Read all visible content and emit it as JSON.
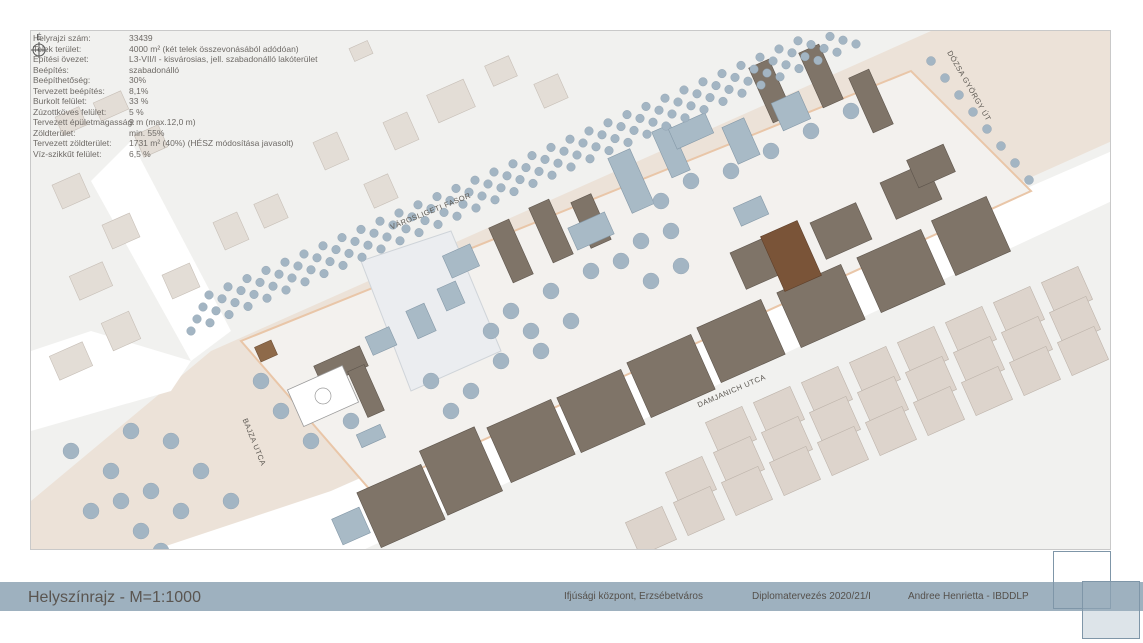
{
  "info": [
    {
      "label": "Helyrajzi szám:",
      "value": "33439"
    },
    {
      "label": "Telek terület:",
      "value": "4000 m² (két telek összevonásából adódóan)"
    },
    {
      "label": "Építési övezet:",
      "value": "L3-VII/I - kisvárosias, jell. szabadonálló lakóterület"
    },
    {
      "label": "Beépítés:",
      "value": "szabadonálló"
    },
    {
      "label": "Beépíthetőség:",
      "value": "30%"
    },
    {
      "label": "Tervezett beépítés:",
      "value": "8,1%"
    },
    {
      "label": "Burkolt felület:",
      "value": "33 %"
    },
    {
      "label": "Zúzottköves felület:",
      "value": "5 %"
    },
    {
      "label": "Tervezett épületmagasság:",
      "value": "9 m (max.12,0 m)"
    },
    {
      "label": "Zöldterület:",
      "value": "min. 55%"
    },
    {
      "label": "Tervezett zöldterület:",
      "value": "1731 m² (40%) (HÉSZ módosítása javasolt)"
    },
    {
      "label": "Víz-szikkűt felület:",
      "value": "6,5 %"
    }
  ],
  "streets": {
    "fasor": "VÁROSLIGETI FASOR",
    "damjanich": "DAMJANICH UTCA",
    "bajza": "BAJZA UTCA",
    "dozsa": "DÓZSA GYÖRGY ÚT"
  },
  "compass": {
    "label": "É"
  },
  "footer": {
    "title": "Helyszínrajz - M=1:1000",
    "project": "Ifjúsági központ, Erzsébetváros",
    "course": "Diplomatervezés 2020/21/I",
    "author": "Andree Henrietta - IBDDLP"
  },
  "colors": {
    "roof": "#7f7468",
    "plan_building": "#a8bac6",
    "tree": "#a3b5c3",
    "street_paving": "#ead9cb",
    "block_buildings": "#ddd4cc",
    "footer_band": "#9eb1bf"
  }
}
